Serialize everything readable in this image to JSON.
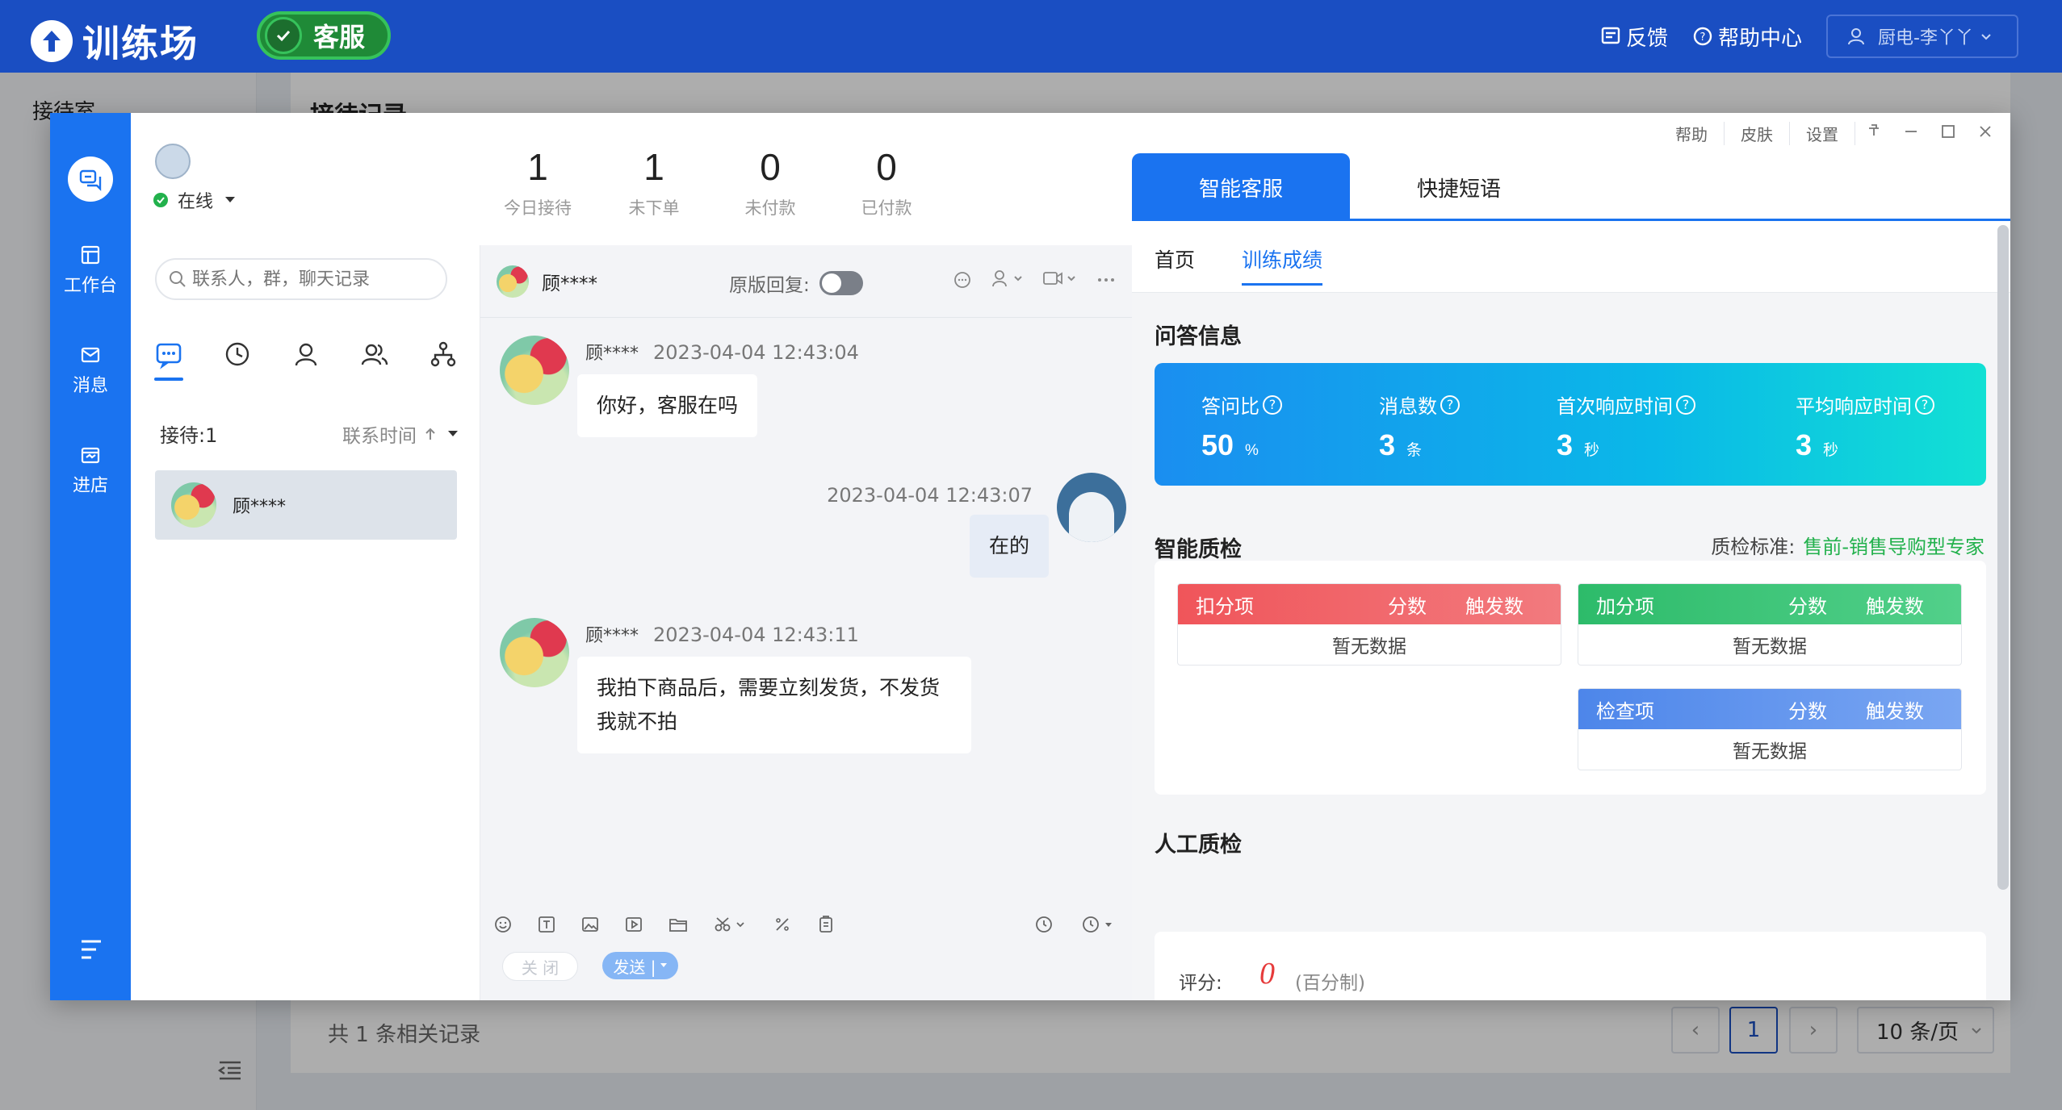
{
  "topbar": {
    "logo_text": "训练场",
    "mode_badge": "客服",
    "feedback": "反馈",
    "help_center": "帮助中心",
    "user": "厨电-李丫丫"
  },
  "background": {
    "nav_title": "接待室",
    "breadcrumb": "接待记录",
    "total_records": "共 1 条相关记录",
    "current_page": "1",
    "page_size": "10 条/页"
  },
  "window": {
    "controls": [
      "帮助",
      "皮肤",
      "设置"
    ],
    "sidebar": {
      "items": [
        {
          "label": "工作台",
          "icon": "workbench-icon"
        },
        {
          "label": "消息",
          "icon": "message-icon"
        },
        {
          "label": "进店",
          "icon": "store-icon"
        }
      ]
    },
    "agent": {
      "status": "在线"
    },
    "stats": [
      {
        "value": "1",
        "label": "今日接待"
      },
      {
        "value": "1",
        "label": "未下单"
      },
      {
        "value": "0",
        "label": "未付款"
      },
      {
        "value": "0",
        "label": "已付款"
      }
    ],
    "contacts": {
      "search_placeholder": "联系人，群，聊天记录",
      "list_count": "接待:1",
      "sort_label": "联系时间",
      "items": [
        {
          "name": "顾****"
        }
      ]
    },
    "chat": {
      "peer_name": "顾****",
      "reply_toggle_label": "原版回复:",
      "reply_toggle_on": false,
      "messages": [
        {
          "from": "customer",
          "name": "顾****",
          "time": "2023-04-04 12:43:04",
          "lines": [
            "你好，客服在吗"
          ]
        },
        {
          "from": "agent",
          "name": "",
          "time": "2023-04-04 12:43:07",
          "lines": [
            "在的"
          ]
        },
        {
          "from": "customer",
          "name": "顾****",
          "time": "2023-04-04 12:43:11",
          "lines": [
            "我拍下商品后，需要立刻发货，不发货",
            "我就不拍"
          ]
        }
      ],
      "close_button": "关 闭",
      "send_button": "发送 |"
    },
    "right_panel": {
      "tabs": [
        "智能客服",
        "快捷短语"
      ],
      "sub_tabs": [
        "首页",
        "训练成绩"
      ],
      "qa_title": "问答信息",
      "kpis": [
        {
          "label": "答问比",
          "value": "50",
          "unit": "%"
        },
        {
          "label": "消息数",
          "value": "3",
          "unit": "条"
        },
        {
          "label": "首次响应时间",
          "value": "3",
          "unit": "秒"
        },
        {
          "label": "平均响应时间",
          "value": "3",
          "unit": "秒"
        }
      ],
      "smart_qc_title": "智能质检",
      "qc_standard_label": "质检标准:",
      "qc_standard_value": "售前-销售导购型专家",
      "tables": [
        {
          "title": "扣分项",
          "col2": "分数",
          "col3": "触发数",
          "empty": "暂无数据",
          "color": "#f0555a"
        },
        {
          "title": "加分项",
          "col2": "分数",
          "col3": "触发数",
          "empty": "暂无数据",
          "color": "#2dbb6a"
        },
        {
          "title": "检查项",
          "col2": "分数",
          "col3": "触发数",
          "empty": "暂无数据",
          "color": "#4d86ea"
        }
      ],
      "manual_qc_title": "人工质检",
      "score_label": "评分:",
      "score_value": "0",
      "score_unit": "(百分制)"
    }
  },
  "colors": {
    "topbar": "#1a4ec2",
    "window_sidebar": "#1a73f0",
    "accent": "#1a73f0",
    "standard_green": "#22b14c",
    "score_red": "#e63b3b"
  }
}
